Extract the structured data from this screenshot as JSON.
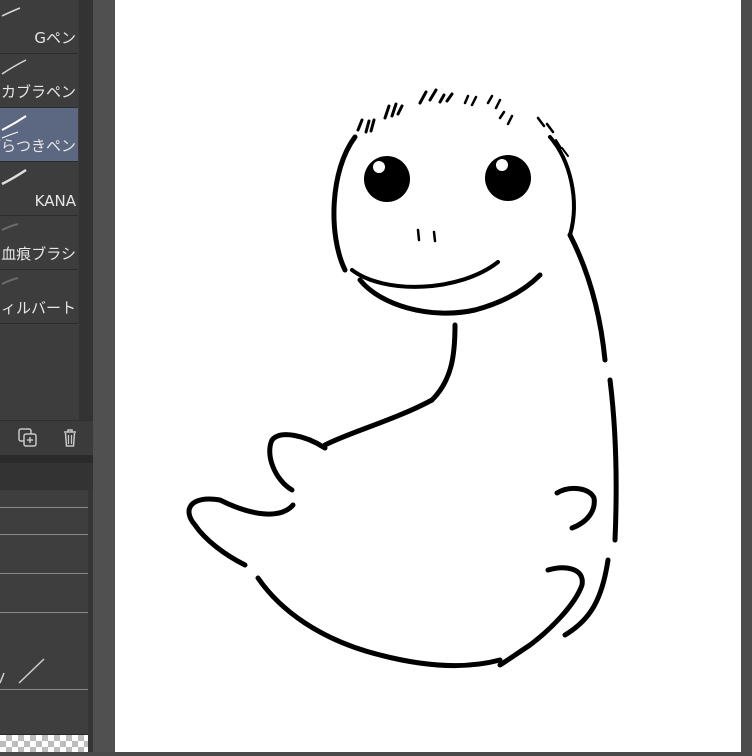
{
  "brush_panel": {
    "items": [
      {
        "label": "Gペン",
        "selected": false
      },
      {
        "label": "カブラペン",
        "selected": false
      },
      {
        "label": "ざらつきペン",
        "selected": true
      },
      {
        "label": "KANA",
        "selected": false
      },
      {
        "label": "血痕ブラシ",
        "selected": false
      },
      {
        "label": "フィルバート",
        "selected": false
      }
    ]
  },
  "toolbar": {
    "duplicate_icon": "copy-add-icon",
    "delete_icon": "trash-icon"
  },
  "colors": {
    "panel_bg": "#3d3d3d",
    "selected_item": "#5c6782",
    "canvas": "#ffffff",
    "ink": "#000000"
  }
}
